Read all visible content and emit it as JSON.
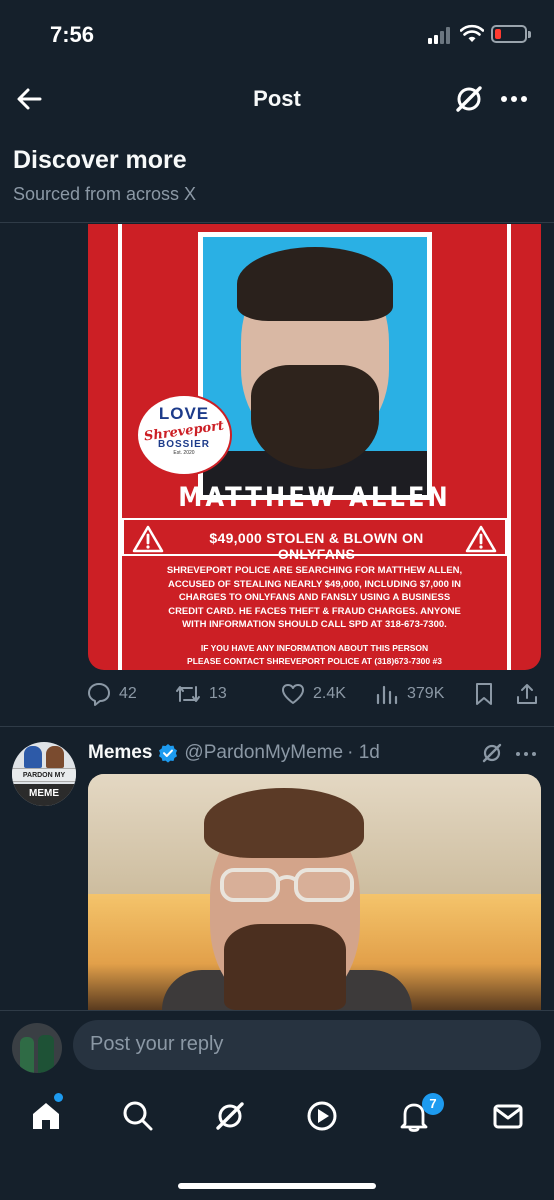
{
  "status_bar": {
    "time": "7:56"
  },
  "header": {
    "title": "Post"
  },
  "discover": {
    "title": "Discover more",
    "subtitle": "Sourced from across X"
  },
  "poster": {
    "logo_love": "LOVE",
    "logo_city": "Shreveport",
    "logo_bossier": "BOSSIER",
    "logo_est": "Est. 2020",
    "name": "MATTHEW ALLEN",
    "banner": "$49,000 STOLEN & BLOWN ON ONLYFANS",
    "body_lines": [
      "SHREVEPORT POLICE ARE SEARCHING FOR MATTHEW ALLEN,",
      "ACCUSED OF STEALING NEARLY $49,000, INCLUDING $7,000 IN",
      "CHARGES TO ONLYFANS AND FANSLY USING A BUSINESS",
      "CREDIT CARD. HE FACES THEFT & FRAUD CHARGES. ANYONE",
      "WITH INFORMATION SHOULD CALL SPD AT 318-673-7300."
    ],
    "contact_lines": [
      "IF YOU HAVE ANY INFORMATION ABOUT THIS PERSON",
      "PLEASE CONTACT SHREVEPORT POLICE AT (318)673-7300 #3"
    ]
  },
  "actions": {
    "replies": "42",
    "reposts": "13",
    "likes": "2.4K",
    "views": "379K"
  },
  "tweet": {
    "name": "Memes",
    "handle": "@PardonMyMeme",
    "time": "· 1d",
    "avatar_top": "PARDON MY",
    "avatar_bottom": "MEME"
  },
  "reply": {
    "placeholder": "Post your reply"
  },
  "tabs": {
    "notifications_badge": "7"
  },
  "colors": {
    "background": "#15202b",
    "accent": "#1d9bf0",
    "poster_red": "#cc1f25",
    "muted": "#8b98a5"
  }
}
